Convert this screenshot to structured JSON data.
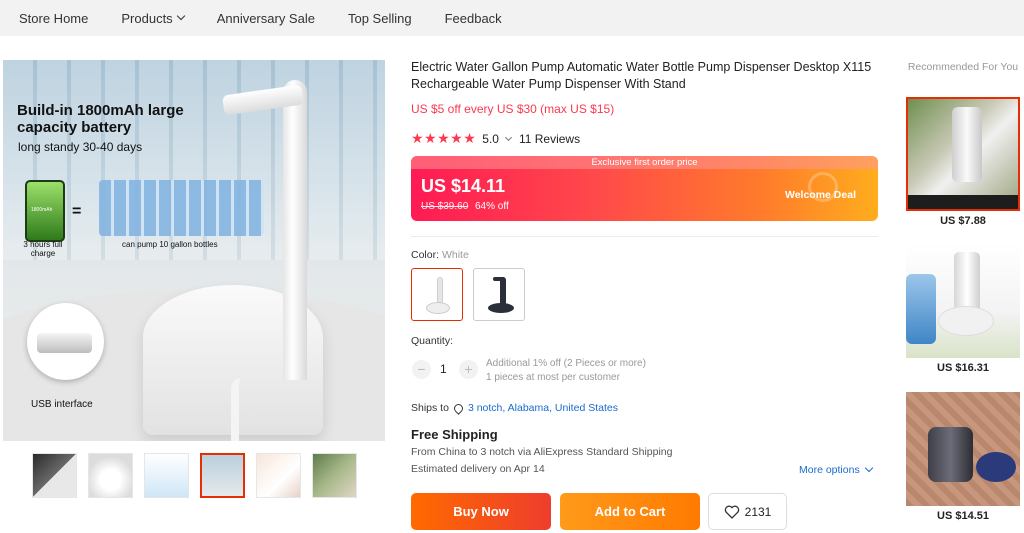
{
  "nav": {
    "items": [
      "Store Home",
      "Products",
      "Anniversary Sale",
      "Top Selling",
      "Feedback"
    ]
  },
  "gallery": {
    "headline": "Build-in 1800mAh large capacity battery",
    "subline": "long standy 30-40 days",
    "battery_label": "1800mAh",
    "charge_caption": "3 hours full charge",
    "bottles_caption": "can pump 10 gallon bottles",
    "usb_caption": "USB interface",
    "thumb_count": 6,
    "active_thumb": 3
  },
  "product": {
    "title": "Electric Water Gallon Pump Automatic Water Bottle Pump Dispenser Desktop X115 Rechargeable Water Pump Dispenser With Stand",
    "promo": "US $5 off every US $30 (max US $15)",
    "stars": "★★★★★",
    "rating": "5.0",
    "reviews": "11 Reviews",
    "price_banner": "Exclusive first order price",
    "price": "US $14.11",
    "old_price": "US $39.60",
    "discount": "64% off",
    "welcome_deal": "Welcome Deal",
    "color_label": "Color:",
    "color_value": "White",
    "quantity_label": "Quantity:",
    "quantity": "1",
    "qty_note_1": "Additional 1% off (2 Pieces or more)",
    "qty_note_2": "1 pieces at most per customer",
    "ships_label": "Ships to",
    "ships_dest": "3 notch, Alabama, United States",
    "free_shipping": "Free Shipping",
    "ship_from": "From China to 3 notch via AliExpress Standard Shipping",
    "delivery": "Estimated delivery on Apr 14",
    "more_options": "More options",
    "buy_now": "Buy Now",
    "add_to_cart": "Add to Cart",
    "wishlist_count": "2131"
  },
  "recommended": {
    "title": "Recommended For You",
    "items": [
      {
        "price": "US $7.88"
      },
      {
        "price": "US $16.31"
      },
      {
        "price": "US $14.51"
      }
    ]
  },
  "colors": {
    "accent": "#e62e04",
    "promo_red": "#fd384f",
    "link_blue": "#1a6bd1",
    "buy_orange": "#ee3d2d",
    "cart_orange": "#ff7a00"
  }
}
